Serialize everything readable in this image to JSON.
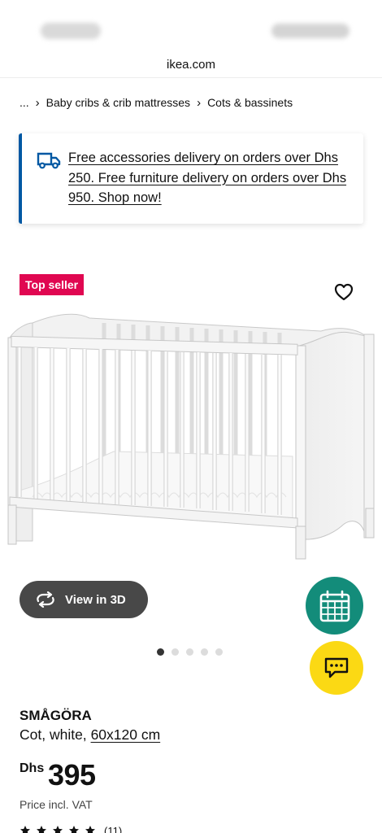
{
  "browser": {
    "url": "ikea.com"
  },
  "breadcrumb": {
    "ellipsis": "...",
    "items": [
      {
        "label": "Baby cribs & crib mattresses"
      },
      {
        "label": "Cots & bassinets"
      }
    ]
  },
  "banner": {
    "icon": "delivery-truck-icon",
    "text": "Free accessories delivery on orders over Dhs 250. Free furniture delivery on orders over Dhs 950. Shop now!"
  },
  "badge": {
    "label": "Top seller",
    "color": "#e00751"
  },
  "gallery": {
    "image": "white-baby-cot-photo",
    "image_count": 5,
    "active_index": 0,
    "view3d_label": "View in 3D"
  },
  "floating_actions": {
    "calendar": {
      "icon": "calendar-icon",
      "color": "#138c7a"
    },
    "chat": {
      "icon": "chat-icon",
      "color": "#fbd914"
    }
  },
  "product": {
    "name": "SMÅGÖRA",
    "description": "Cot, white,",
    "size": "60x120 cm",
    "currency": "Dhs",
    "price": "395",
    "price_note": "Price incl. VAT",
    "rating_count": "(11)",
    "rating_stars": 5
  },
  "colors": {
    "ikea_blue": "#0058a3",
    "button_dark": "#484848"
  }
}
